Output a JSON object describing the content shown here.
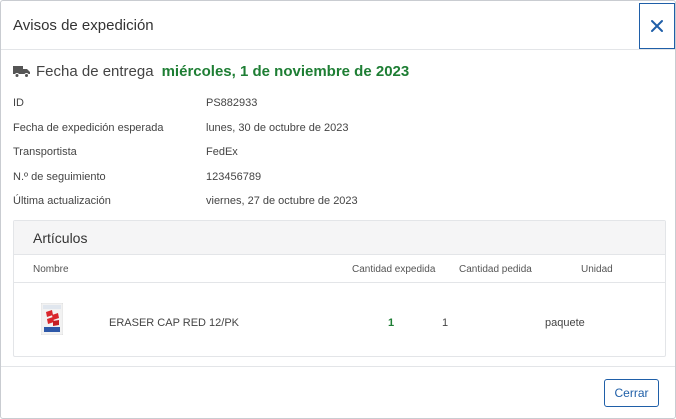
{
  "dialog": {
    "title": "Avisos de expedición",
    "close_icon": "close-icon"
  },
  "delivery": {
    "icon": "truck-icon",
    "label": "Fecha de entrega",
    "date": "miércoles, 1 de noviembre de 2023",
    "date_color": "#1e7e34"
  },
  "info": {
    "id_label": "ID",
    "id_value": "PS882933",
    "expected_label": "Fecha de expedición esperada",
    "expected_value": "lunes, 30 de octubre de 2023",
    "carrier_label": "Transportista",
    "carrier_value": "FedEx",
    "tracking_label": "N.º de seguimiento",
    "tracking_value": "123456789",
    "updated_label": "Última actualización",
    "updated_value": "viernes, 27 de octubre de 2023"
  },
  "articles": {
    "title": "Artículos",
    "columns": {
      "name": "Nombre",
      "shipped_qty": "Cantidad expedida",
      "ordered_qty": "Cantidad pedida",
      "unit": "Unidad"
    },
    "items": [
      {
        "image_icon": "eraser-cap-product-image",
        "name": "ERASER CAP RED 12/PK",
        "shipped_qty": "1",
        "ordered_qty": "1",
        "unit": "paquete"
      }
    ]
  },
  "footer": {
    "close_label": "Cerrar"
  },
  "colors": {
    "accent": "#1f5fa8",
    "success": "#1e7e34",
    "border": "#e3e5e8"
  }
}
